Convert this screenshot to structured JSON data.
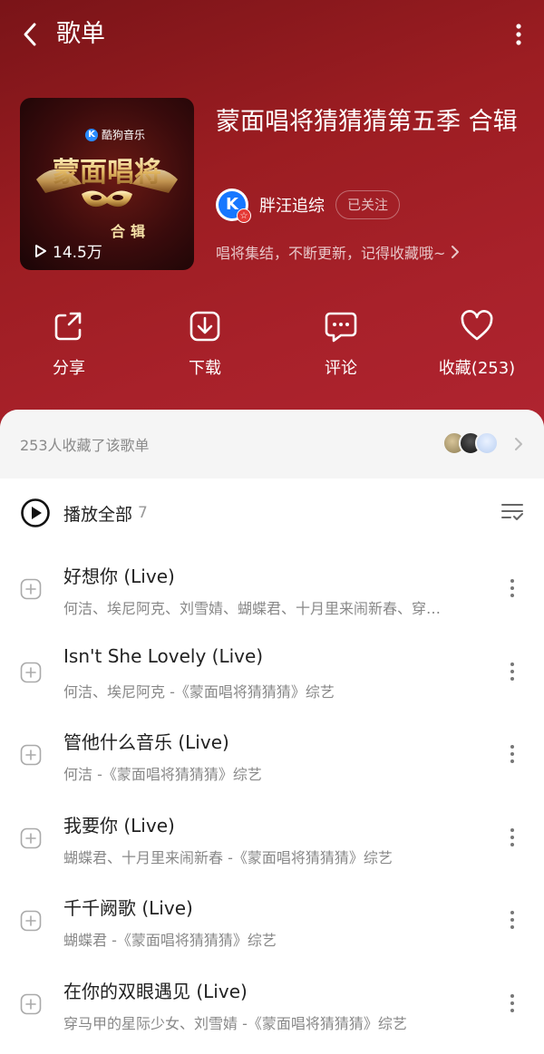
{
  "header": {
    "title": "歌单"
  },
  "playlist": {
    "title": "蒙面唱将猜猜猜第五季 合辑",
    "cover": {
      "brand": "酷狗音乐",
      "art_text": "蒙面唱将",
      "subtitle": "合辑",
      "play_count": "14.5万"
    },
    "creator": {
      "name": "胖汪追综",
      "follow_label": "已关注"
    },
    "description": "唱将集结，不断更新，记得收藏哦~"
  },
  "actions": [
    {
      "label": "分享",
      "icon": "share-icon"
    },
    {
      "label": "下载",
      "icon": "download-icon"
    },
    {
      "label": "评论",
      "icon": "comment-icon"
    },
    {
      "label": "收藏(253)",
      "icon": "heart-icon"
    }
  ],
  "collectors": {
    "text": "253人收藏了该歌单"
  },
  "play_all": {
    "label": "播放全部",
    "count": "7"
  },
  "songs": [
    {
      "title": "好想你 (Live)",
      "artist": "何洁、埃尼阿克、刘雪婧、蝴蝶君、十月里来闹新春、穿…"
    },
    {
      "title": "Isn't She Lovely (Live)",
      "artist": "何洁、埃尼阿克 -《蒙面唱将猜猜猜》综艺"
    },
    {
      "title": "管他什么音乐 (Live)",
      "artist": "何洁 -《蒙面唱将猜猜猜》综艺"
    },
    {
      "title": "我要你 (Live)",
      "artist": "蝴蝶君、十月里来闹新春 -《蒙面唱将猜猜猜》综艺"
    },
    {
      "title": "千千阙歌 (Live)",
      "artist": "蝴蝶君 -《蒙面唱将猜猜猜》综艺"
    },
    {
      "title": "在你的双眼遇见 (Live)",
      "artist": "穿马甲的星际少女、刘雪婧 -《蒙面唱将猜猜猜》综艺"
    }
  ],
  "colors": {
    "hero": "#9c1d22",
    "accent": "#1677ff",
    "badge": "#e53935"
  }
}
